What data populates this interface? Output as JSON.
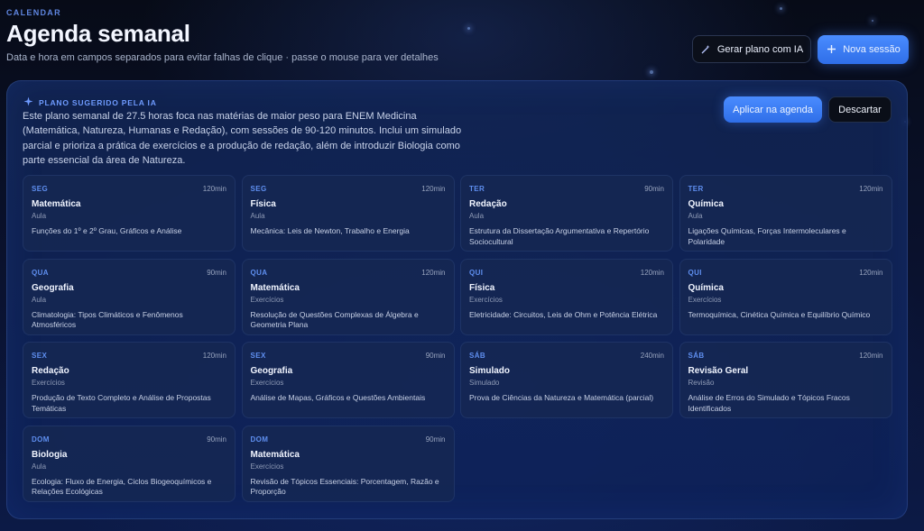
{
  "header": {
    "eyebrow": "CALENDAR",
    "title": "Agenda semanal",
    "subtitle": "Data e hora em campos separados para evitar falhas de clique · passe o mouse para ver detalhes",
    "ai_button_label": "Gerar plano com IA",
    "ai_button_icon": "sparkles-icon",
    "new_session_label": "Nova sessão",
    "new_session_icon": "plus-icon"
  },
  "plan": {
    "tag": "PLANO SUGERIDO PELA IA",
    "tag_icon": "sparkles-icon",
    "description": "Este plano semanal de 27.5 horas foca nas matérias de maior peso para ENEM Medicina (Matemática, Natureza, Humanas e Redação), com sessões de 90-120 minutos. Inclui um simulado parcial e prioriza a prática de exercícios e a produção de redação, além de introduzir Biologia como parte essencial da área de Natureza.",
    "apply_label": "Aplicar na agenda",
    "discard_label": "Descartar",
    "sessions": [
      {
        "day": "SEG",
        "duration": "120min",
        "subject": "Matemática",
        "kind": "Aula",
        "topic": "Funções do 1º e 2º Grau, Gráficos e Análise"
      },
      {
        "day": "SEG",
        "duration": "120min",
        "subject": "Física",
        "kind": "Aula",
        "topic": "Mecânica: Leis de Newton, Trabalho e Energia"
      },
      {
        "day": "TER",
        "duration": "90min",
        "subject": "Redação",
        "kind": "Aula",
        "topic": "Estrutura da Dissertação Argumentativa e Repertório Sociocultural"
      },
      {
        "day": "TER",
        "duration": "120min",
        "subject": "Química",
        "kind": "Aula",
        "topic": "Ligações Químicas, Forças Intermoleculares e Polaridade"
      },
      {
        "day": "QUA",
        "duration": "90min",
        "subject": "Geografia",
        "kind": "Aula",
        "topic": "Climatologia: Tipos Climáticos e Fenômenos Atmosféricos"
      },
      {
        "day": "QUA",
        "duration": "120min",
        "subject": "Matemática",
        "kind": "Exercícios",
        "topic": "Resolução de Questões Complexas de Álgebra e Geometria Plana"
      },
      {
        "day": "QUI",
        "duration": "120min",
        "subject": "Física",
        "kind": "Exercícios",
        "topic": "Eletricidade: Circuitos, Leis de Ohm e Potência Elétrica"
      },
      {
        "day": "QUI",
        "duration": "120min",
        "subject": "Química",
        "kind": "Exercícios",
        "topic": "Termoquímica, Cinética Química e Equilíbrio Químico"
      },
      {
        "day": "SEX",
        "duration": "120min",
        "subject": "Redação",
        "kind": "Exercícios",
        "topic": "Produção de Texto Completo e Análise de Propostas Temáticas"
      },
      {
        "day": "SEX",
        "duration": "90min",
        "subject": "Geografia",
        "kind": "Exercícios",
        "topic": "Análise de Mapas, Gráficos e Questões Ambientais"
      },
      {
        "day": "SÁB",
        "duration": "240min",
        "subject": "Simulado",
        "kind": "Simulado",
        "topic": "Prova de Ciências da Natureza e Matemática (parcial)"
      },
      {
        "day": "SÁB",
        "duration": "120min",
        "subject": "Revisão Geral",
        "kind": "Revisão",
        "topic": "Análise de Erros do Simulado e Tópicos Fracos Identificados"
      },
      {
        "day": "DOM",
        "duration": "90min",
        "subject": "Biologia",
        "kind": "Aula",
        "topic": "Ecologia: Fluxo de Energia, Ciclos Biogeoquímicos e Relações Ecológicas"
      },
      {
        "day": "DOM",
        "duration": "90min",
        "subject": "Matemática",
        "kind": "Exercícios",
        "topic": "Revisão de Tópicos Essenciais: Porcentagem, Razão e Proporção"
      }
    ]
  },
  "colors": {
    "accent": "#3f7ff5",
    "background": "#0a1230",
    "panel": "#13296a"
  }
}
